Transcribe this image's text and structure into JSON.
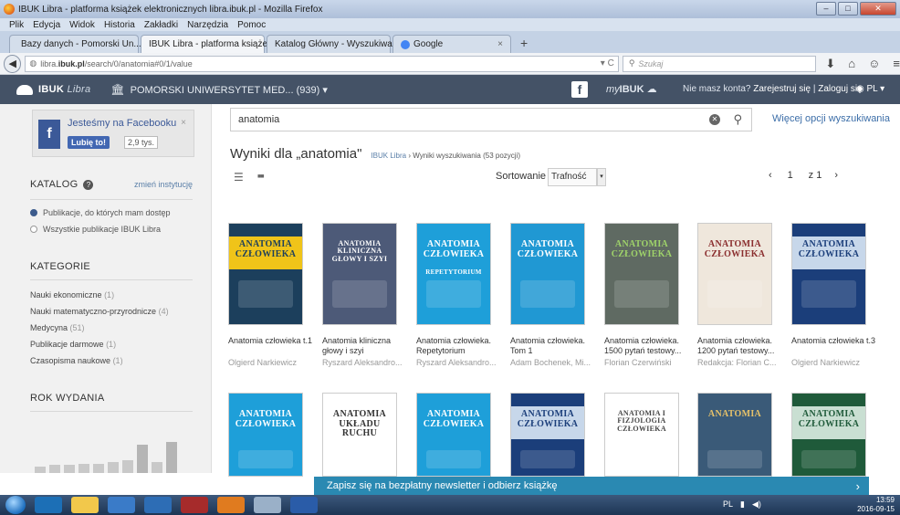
{
  "window": {
    "title": "IBUK Libra - platforma książek elektronicznych libra.ibuk.pl - Mozilla Firefox"
  },
  "menu": [
    "Plik",
    "Edycja",
    "Widok",
    "Historia",
    "Zakładki",
    "Narzędzia",
    "Pomoc"
  ],
  "tabs": [
    {
      "label": "Bazy danych - Pomorski Un...",
      "icon_color": "#d9822b"
    },
    {
      "label": "IBUK Libra - platforma książek ...",
      "icon_color": "#ffffff"
    },
    {
      "label": "Katalog Główny - Wyszukiwanie",
      "icon_color": "#ffffff"
    },
    {
      "label": "Google",
      "icon_color": "#4285f4"
    }
  ],
  "nav": {
    "url_prefix": "libra.",
    "url_host": "ibuk.pl",
    "url_path": "/search/0/anatomia#0/1/value",
    "search_placeholder": "Szukaj"
  },
  "header": {
    "brand": "IBUK",
    "brand_sub": "Libra",
    "institution": "POMORSKI UNIWERSYTET MED... (939) ▾",
    "fb_letter": "f",
    "myibuk_prefix": "my",
    "myibuk": "IBUK",
    "no_account": "Nie masz konta?",
    "register": "Zarejestruj się",
    "sep": "|",
    "login": "Zaloguj się",
    "lang": "PL ▾"
  },
  "sidebar": {
    "fb_box": {
      "text": "Jesteśmy na Facebooku",
      "like": "Lubię to!",
      "count": "2,9 tys.",
      "close": "×"
    },
    "katalog_title": "KATALOG",
    "katalog_change": "zmień instytucję",
    "access_options": [
      {
        "label": "Publikacje, do których mam dostęp",
        "selected": true
      },
      {
        "label": "Wszystkie publikacje IBUK Libra",
        "selected": false
      }
    ],
    "categories_title": "KATEGORIE",
    "categories": [
      {
        "name": "Nauki ekonomiczne",
        "count": "(1)"
      },
      {
        "name": "Nauki matematyczno-przyrodnicze",
        "count": "(4)"
      },
      {
        "name": "Medycyna",
        "count": "(51)"
      },
      {
        "name": "Publikacje darmowe",
        "count": "(1)"
      },
      {
        "name": "Czasopisma naukowe",
        "count": "(1)"
      }
    ],
    "year_title": "ROK WYDANIA",
    "year_histogram": [
      0.2,
      0.25,
      0.25,
      0.3,
      0.3,
      0.35,
      0.4,
      0.9,
      0.35,
      1.0
    ]
  },
  "search": {
    "query": "anatomia",
    "advanced_link": "Więcej opcji wyszukiwania"
  },
  "results": {
    "heading": "Wyniki dla „anatomia\"",
    "crumb_link": "IBUK Libra",
    "crumb_sep": "›",
    "crumb_current": "Wyniki wyszukiwania (53 pozycji)",
    "sort_label": "Sortowanie",
    "sort_value": "Trafność",
    "page_prev": "‹",
    "page_current": "1",
    "page_total": "z 1",
    "page_next": "›",
    "icon_list": "☰",
    "icon_grid": "■■"
  },
  "books_row1": [
    {
      "title": "Anatomia człowieka t.1",
      "author": "Olgierd Narkiewicz",
      "cover_title": "ANATOMIA CZŁOWIEKA",
      "cover_bg": "#1c3f5c",
      "title_bg": "#f0c419",
      "title_color": "#1c3f5c"
    },
    {
      "title": "Anatomia kliniczna głowy i szyi",
      "author": "Ryszard Aleksandro...",
      "cover_title": "ANATOMIA KLINICZNA GŁOWY I SZYI",
      "cover_bg": "#4d5a78",
      "title_bg": "#4d5a78",
      "title_color": "#ffffff"
    },
    {
      "title": "Anatomia człowieka. Repetytorium",
      "author": "Ryszard Aleksandro...",
      "cover_title": "ANATOMIA CZŁOWIEKA",
      "cover_sub": "REPETYTORIUM",
      "cover_bg": "#1e9fd9",
      "title_bg": "#1e9fd9",
      "title_color": "#ffffff"
    },
    {
      "title": "Anatomia człowieka. Tom 1",
      "author": "Adam Bochenek, Mi...",
      "cover_title": "ANATOMIA CZŁOWIEKA",
      "cover_bg": "#2098d3",
      "title_bg": "#2098d3",
      "title_color": "#ffffff"
    },
    {
      "title": "Anatomia człowieka. 1500 pytań testowy...",
      "author": "Florian Czerwiński",
      "cover_title": "ANATOMIA CZŁOWIEKA",
      "cover_bg": "#5f6a62",
      "title_bg": "#5f6a62",
      "title_color": "#9fd36a"
    },
    {
      "title": "Anatomia człowieka. 1200 pytań testowy...",
      "author": "Redakcja: Florian C...",
      "cover_title": "ANATOMIA CZŁOWIEKA",
      "cover_bg": "#efe7dc",
      "title_bg": "#efe7dc",
      "title_color": "#8a2d2d"
    },
    {
      "title": "Anatomia człowieka t.3",
      "author": "Olgierd Narkiewicz",
      "cover_title": "ANATOMIA CZŁOWIEKA",
      "cover_bg": "#1b3e7a",
      "title_bg": "#c7d7ea",
      "title_color": "#1b3e7a"
    }
  ],
  "books_row2": [
    {
      "cover_title": "ANATOMIA CZŁOWIEKA",
      "cover_bg": "#1e9fd9",
      "title_bg": "#1e9fd9",
      "title_color": "#ffffff"
    },
    {
      "cover_title": "ANATOMIA UKŁADU RUCHU",
      "cover_bg": "#ffffff",
      "title_bg": "#ffffff",
      "title_color": "#333333"
    },
    {
      "cover_title": "ANATOMIA CZŁOWIEKA",
      "cover_bg": "#1e9fd9",
      "title_bg": "#1e9fd9",
      "title_color": "#ffffff"
    },
    {
      "cover_title": "ANATOMIA CZŁOWIEKA",
      "cover_bg": "#1b3e7a",
      "title_bg": "#c7d7ea",
      "title_color": "#1b3e7a"
    },
    {
      "cover_title": "ANATOMIA I FIZJOLOGIA CZŁOWIEKA",
      "cover_bg": "#ffffff",
      "title_bg": "#ffffff",
      "title_color": "#444444"
    },
    {
      "cover_title": "ANATOMIA",
      "cover_bg": "#3a5a78",
      "title_bg": "#3a5a78",
      "title_color": "#e8c36a"
    },
    {
      "cover_title": "ANATOMIA CZŁOWIEKA",
      "cover_bg": "#1f5a3a",
      "title_bg": "#c9dfd2",
      "title_color": "#1f5a3a"
    }
  ],
  "newsletter": {
    "text": "Zapisz się na bezpłatny newsletter i odbierz książkę",
    "arrow": "›"
  },
  "taskbar": {
    "items": [
      "#1c6fb6",
      "#f2c84b",
      "#3a7bc8",
      "#2d6db5",
      "#a62b2b",
      "#e07b1f",
      "#9ab0c8",
      "#2a5ca8"
    ],
    "tray_lang": "PL",
    "time": "13:59",
    "date": "2016-09-15"
  },
  "colors": {
    "header_bg": "#445266",
    "link": "#3c6ea8",
    "banner": "#2a89b2"
  }
}
